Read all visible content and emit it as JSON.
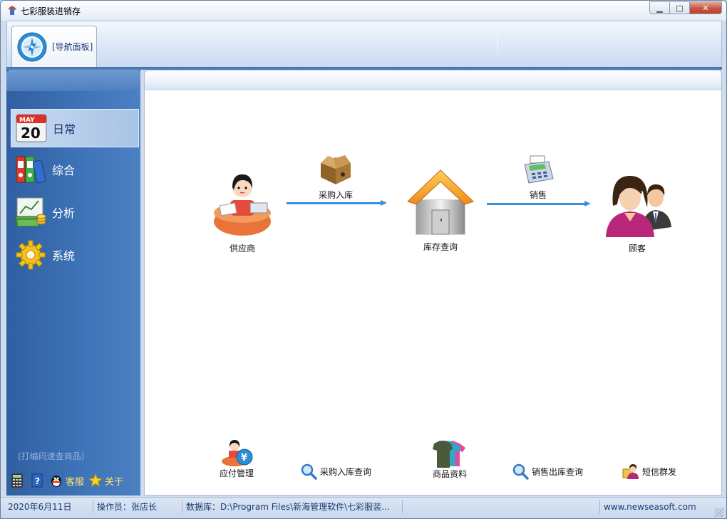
{
  "window": {
    "title": "七彩服装进销存",
    "controls": {
      "minimize": "▁",
      "maximize": "□",
      "close": "✕"
    }
  },
  "ribbon": {
    "nav_tab_label": "[导航面板]",
    "nav_tab_icon": "compass-icon"
  },
  "sidebar": {
    "items": [
      {
        "label": "日常",
        "icon": "calendar-icon",
        "calendar_month": "MAY",
        "calendar_day": "20",
        "active": true
      },
      {
        "label": "综合",
        "icon": "binders-icon",
        "active": false
      },
      {
        "label": "分析",
        "icon": "chart-money-icon",
        "active": false
      },
      {
        "label": "系统",
        "icon": "gear-icon",
        "active": false
      }
    ],
    "hint": "(打编码速查商品)",
    "tools": {
      "calculator_icon": "calculator-icon",
      "help_icon": "help-icon",
      "service_label": "客服",
      "about_label": "关于"
    }
  },
  "flow": {
    "supplier": "供应商",
    "purchase_in": "采购入库",
    "inventory_query": "库存查询",
    "sales": "销售",
    "customer": "顾客"
  },
  "bottom_links": {
    "payable": "应付管理",
    "purchase_query": "采购入库查询",
    "product_info": "商品资料",
    "sales_query": "销售出库查询",
    "sms": "短信群发"
  },
  "status": {
    "date": "2020年6月11日",
    "operator": "操作员：张店长",
    "database": "数据库：D:\\Program Files\\新海管理软件\\七彩服装...",
    "website": "www.newseasoft.com"
  },
  "colors": {
    "sidebar_blue": "#3f75b9",
    "arrow_blue": "#3b8ee0",
    "tool_yellow": "#ffe66a"
  }
}
